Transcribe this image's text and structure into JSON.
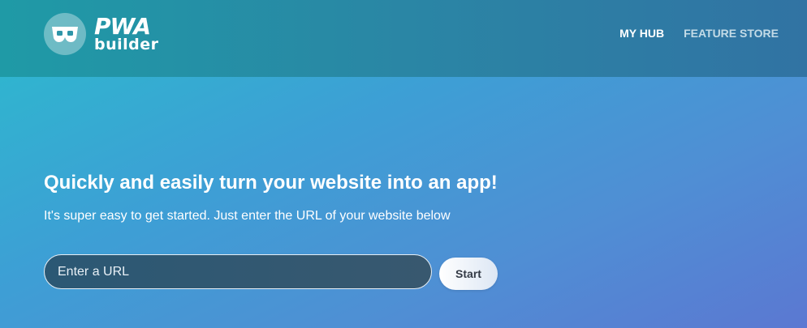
{
  "header": {
    "logo": {
      "line1": "PWA",
      "line2": "builder",
      "icon": "pwa-goggles-icon"
    },
    "nav": [
      {
        "label": "MY HUB",
        "active": true
      },
      {
        "label": "FEATURE STORE",
        "active": false
      }
    ]
  },
  "hero": {
    "title": "Quickly and easily turn your website into an app!",
    "subtitle": "It's super easy to get started. Just enter the URL of your website below"
  },
  "url_form": {
    "placeholder": "Enter a URL",
    "value": "",
    "start_label": "Start"
  },
  "colors": {
    "header_bg": "#2a86a5",
    "page_gradient_start": "#2bbccd",
    "page_gradient_end": "#5b78d2",
    "input_bg": "#2b5874",
    "button_bg": "#ffffff",
    "button_text": "#333a45"
  }
}
